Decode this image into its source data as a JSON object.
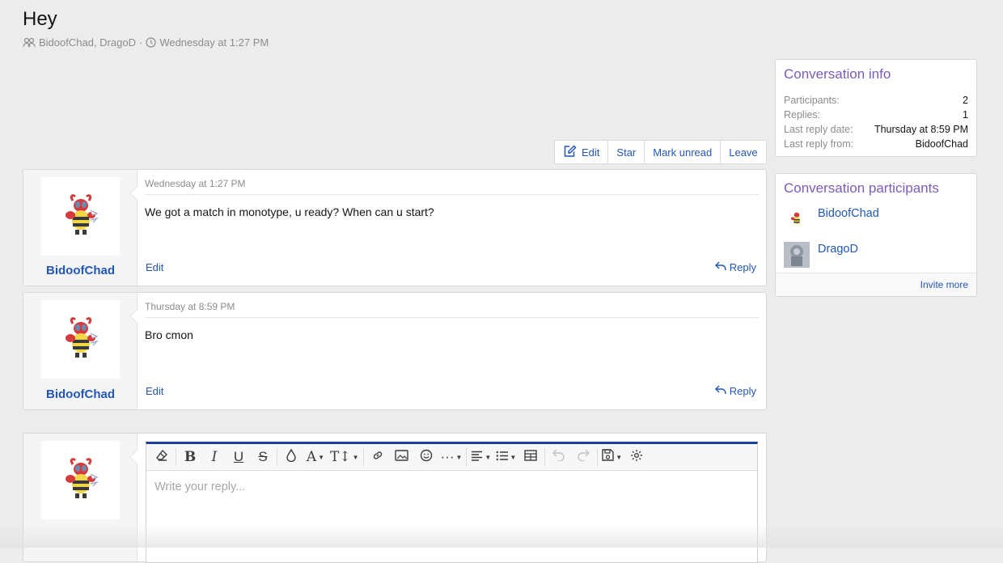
{
  "header": {
    "title": "Hey",
    "participants_text": "BidoofChad, DragoD",
    "separator": "·",
    "date_text": "Wednesday at 1:27 PM"
  },
  "actions": {
    "edit": "Edit",
    "star": "Star",
    "mark_unread": "Mark unread",
    "leave": "Leave"
  },
  "messages": [
    {
      "username": "BidoofChad",
      "date": "Wednesday at 1:27 PM",
      "body": "We got a match in monotype, u ready? When can u start?",
      "edit_label": "Edit",
      "reply_label": "Reply"
    },
    {
      "username": "BidoofChad",
      "date": "Thursday at 8:59 PM",
      "body": "Bro cmon",
      "edit_label": "Edit",
      "reply_label": "Reply"
    }
  ],
  "editor": {
    "placeholder": "Write your reply..."
  },
  "conversation_info": {
    "title": "Conversation info",
    "rows": [
      {
        "label": "Participants:",
        "value": "2"
      },
      {
        "label": "Replies:",
        "value": "1"
      },
      {
        "label": "Last reply date:",
        "value": "Thursday at 8:59 PM"
      },
      {
        "label": "Last reply from:",
        "value": "BidoofChad"
      }
    ]
  },
  "participants_block": {
    "title": "Conversation participants",
    "people": [
      {
        "name": "BidoofChad"
      },
      {
        "name": "DragoD"
      }
    ],
    "invite_label": "Invite more"
  },
  "colors": {
    "link": "#2357b5",
    "sidebar_title": "#7b5cb8",
    "editor_accent": "#1f3fa0"
  }
}
